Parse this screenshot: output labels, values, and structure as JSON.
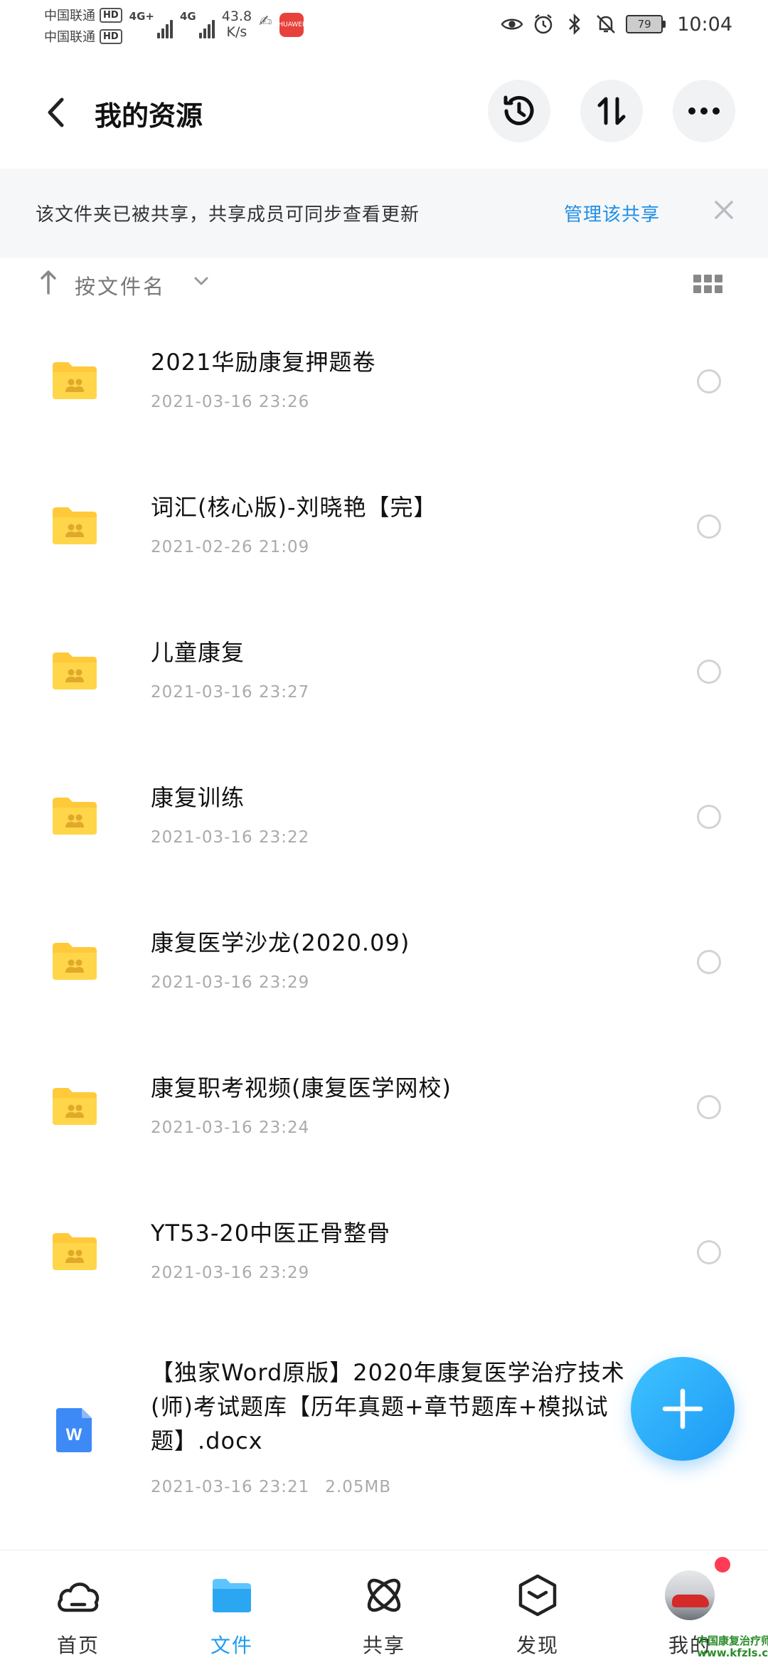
{
  "status_bar": {
    "carrier1": "中国联通",
    "carrier2": "中国联通",
    "hd1": "HD",
    "hd2": "HD",
    "net1": "4G+",
    "net2": "4G",
    "speed_value": "43.8",
    "speed_unit": "K/s",
    "app_badge": "HUAWEI",
    "battery": "79",
    "time": "10:04"
  },
  "header": {
    "title": "我的资源",
    "icons": [
      "back-arrow-icon",
      "history-icon",
      "transfer-icon",
      "more-icon"
    ]
  },
  "banner": {
    "text": "该文件夹已被共享，共享成员可同步查看更新",
    "link": "管理该共享"
  },
  "sort": {
    "label": "按文件名"
  },
  "files": [
    {
      "name": "2021华励康复押题卷",
      "date": "2021-03-16  23:26",
      "type": "shared-folder"
    },
    {
      "name": "词汇(核心版)-刘晓艳【完】",
      "date": "2021-02-26  21:09",
      "type": "shared-folder"
    },
    {
      "name": "儿童康复",
      "date": "2021-03-16  23:27",
      "type": "shared-folder"
    },
    {
      "name": "康复训练",
      "date": "2021-03-16  23:22",
      "type": "shared-folder"
    },
    {
      "name": "康复医学沙龙(2020.09)",
      "date": "2021-03-16  23:29",
      "type": "shared-folder"
    },
    {
      "name": "康复职考视频(康复医学网校)",
      "date": "2021-03-16  23:24",
      "type": "shared-folder"
    },
    {
      "name": "YT53-20中医正骨整骨",
      "date": "2021-03-16  23:29",
      "type": "shared-folder"
    },
    {
      "name": "【独家Word原版】2020年康复医学治疗技术(师)考试题库【历年真题+章节题库+模拟试题】.docx",
      "date": "2021-03-16  23:21",
      "size": "2.05MB",
      "type": "word-doc"
    }
  ],
  "bottom_nav": {
    "items": [
      {
        "label": "首页",
        "icon": "cloud-icon",
        "active": false
      },
      {
        "label": "文件",
        "icon": "folder-icon",
        "active": true
      },
      {
        "label": "共享",
        "icon": "atom-icon",
        "active": false
      },
      {
        "label": "发现",
        "icon": "cube-icon",
        "active": false
      },
      {
        "label": "我的",
        "icon": "avatar",
        "active": false
      }
    ]
  },
  "watermark": {
    "line1": "中国康复治疗师",
    "line2": "www.kfzls.com"
  },
  "colors": {
    "accent": "#1e9bf0",
    "link": "#1e8fe6",
    "folder": "#ffd64a",
    "doc_icon": "#3d8af7",
    "fab_start": "#3fc3ff",
    "fab_end": "#1c98f5"
  }
}
